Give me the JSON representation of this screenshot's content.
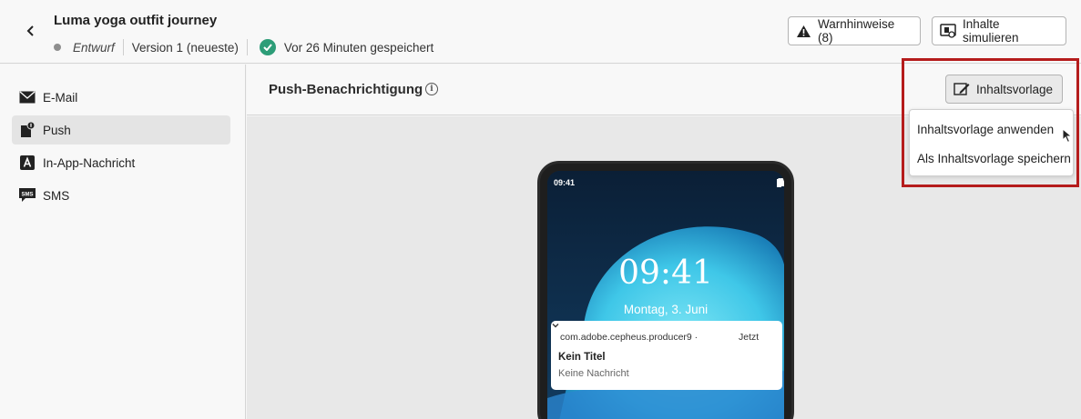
{
  "header": {
    "title": "Luma yoga outfit journey",
    "status": "Entwurf",
    "version": "Version 1 (neueste)",
    "saved": "Vor 26 Minuten gespeichert",
    "warnings_label": "Warnhinweise (8)",
    "simulate_label": "Inhalte simulieren"
  },
  "sidebar": {
    "items": [
      {
        "label": "E-Mail",
        "icon": "mail-icon"
      },
      {
        "label": "Push",
        "icon": "push-icon",
        "active": true
      },
      {
        "label": "In-App-Nachricht",
        "icon": "in-app-icon"
      },
      {
        "label": "SMS",
        "icon": "sms-icon"
      }
    ]
  },
  "main": {
    "title": "Push-Benachrichtigung",
    "template_button": "Inhaltsvorlage",
    "menu": [
      "Inhaltsvorlage anwenden",
      "Als Inhaltsvorlage speichern"
    ]
  },
  "phone": {
    "statusbar_time": "09:41",
    "clock": "09:41",
    "date": "Montag, 3. Juni",
    "notification": {
      "app": "com.adobe.cepheus.producer9 ·",
      "time": "Jetzt",
      "title": "Kein Titel",
      "body": "Keine Nachricht"
    }
  },
  "colors": {
    "success": "#2d9d78",
    "highlight": "#b51c1c",
    "wallpaper_dark": "#0d2a44",
    "wallpaper_accent": "#3fc7e8"
  }
}
